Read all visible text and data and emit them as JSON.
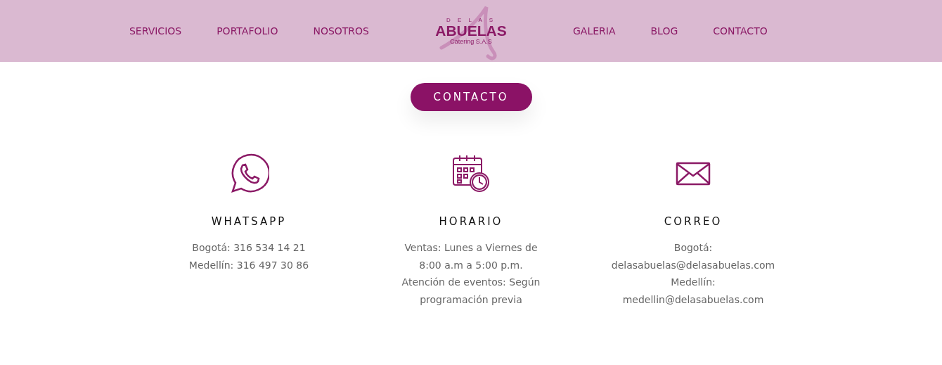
{
  "nav": {
    "left": [
      {
        "label": "SERVICIOS"
      },
      {
        "label": "PORTAFOLIO"
      },
      {
        "label": "NOSOTROS"
      }
    ],
    "logo": {
      "top": "D E L A S",
      "main": "ABUELAS",
      "sub": "Catering S.A.S"
    },
    "right": [
      {
        "label": "GALERIA"
      },
      {
        "label": "BLOG"
      },
      {
        "label": "CONTACTO"
      }
    ]
  },
  "button": "CONTACTO",
  "cards": [
    {
      "kind": "whatsapp",
      "title": "WHATSAPP",
      "lines": [
        "Bogotá: 316 534 14 21",
        "Medellín: 316 497 30 86"
      ]
    },
    {
      "kind": "calendar",
      "title": "HORARIO",
      "lines": [
        "Ventas: Lunes a Viernes de",
        "8:00 a.m a 5:00 p.m.",
        "Atención de eventos: Según",
        "programación previa"
      ]
    },
    {
      "kind": "mail",
      "title": "CORREO",
      "lines": [
        "Bogotá:",
        "delasabuelas@delasabuelas.com",
        "Medellín:",
        "medellin@delasabuelas.com"
      ]
    }
  ]
}
